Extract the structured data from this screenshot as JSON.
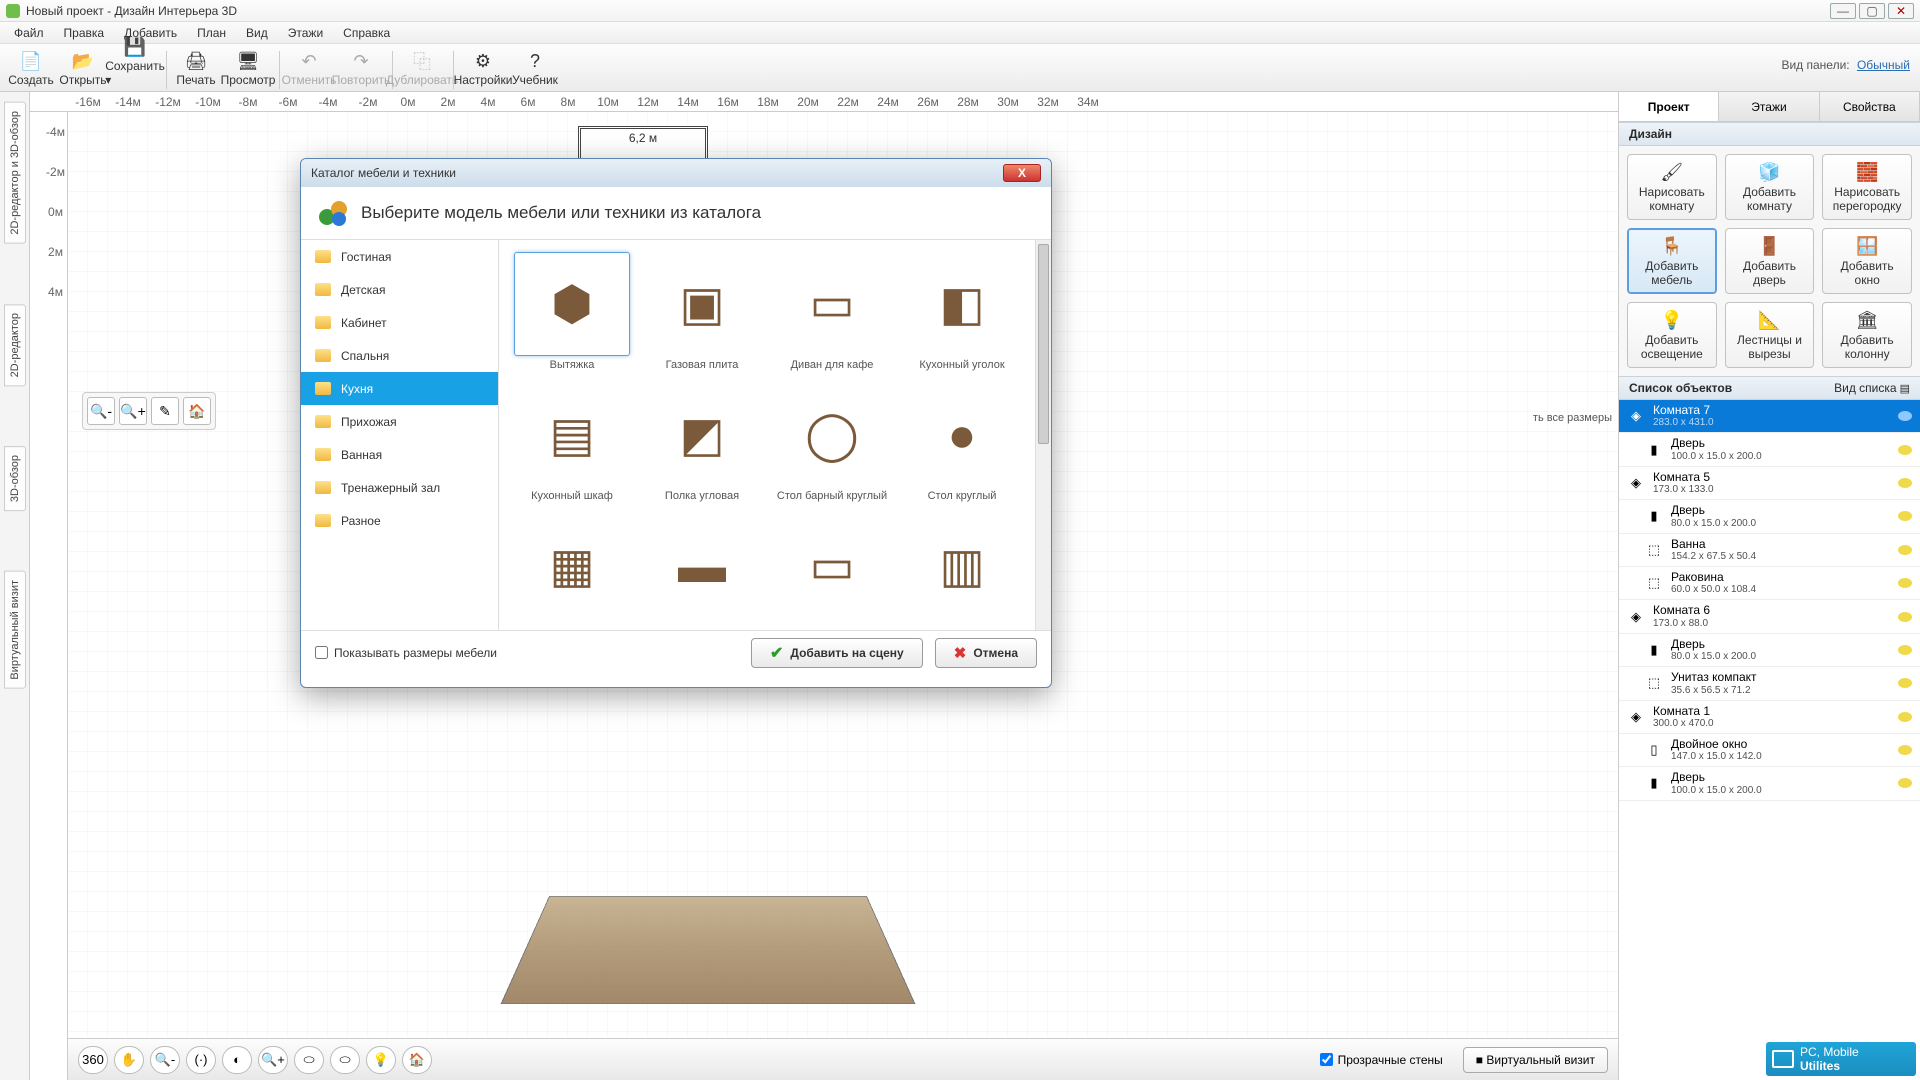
{
  "window": {
    "title": "Новый проект - Дизайн Интерьера 3D"
  },
  "menu": [
    "Файл",
    "Правка",
    "Добавить",
    "План",
    "Вид",
    "Этажи",
    "Справка"
  ],
  "toolbar": {
    "items": [
      {
        "label": "Создать",
        "icon": "📄"
      },
      {
        "label": "Открыть",
        "icon": "📂"
      },
      {
        "label": "Сохранить",
        "icon": "💾",
        "dropdown": true
      }
    ],
    "items2": [
      {
        "label": "Печать",
        "icon": "🖨"
      },
      {
        "label": "Просмотр",
        "icon": "🖥"
      }
    ],
    "items3": [
      {
        "label": "Отменить",
        "icon": "↶",
        "disabled": true
      },
      {
        "label": "Повторить",
        "icon": "↷",
        "disabled": true
      }
    ],
    "items4": [
      {
        "label": "Дублировать",
        "icon": "⿻",
        "disabled": true
      }
    ],
    "items5": [
      {
        "label": "Настройки",
        "icon": "⚙"
      },
      {
        "label": "Учебник",
        "icon": "?"
      }
    ],
    "panel_label": "Вид панели:",
    "panel_mode": "Обычный"
  },
  "left_tabs": [
    "2D-редактор и 3D-обзор",
    "2D-редактор",
    "3D-обзор",
    "Виртуальный визит"
  ],
  "ruler_h": [
    "-16м",
    "-14м",
    "-12м",
    "-10м",
    "-8м",
    "-6м",
    "-4м",
    "-2м",
    "0м",
    "2м",
    "4м",
    "6м",
    "8м",
    "10м",
    "12м",
    "14м",
    "16м",
    "18м",
    "20м",
    "22м",
    "24м",
    "26м",
    "28м",
    "30м",
    "32м",
    "34м"
  ],
  "ruler_v": [
    "-4м",
    "-2м",
    "0м",
    "2м",
    "4м"
  ],
  "room_label": "6,2 м",
  "palette": [
    "🔍-",
    "🔍+",
    "✎",
    "🏠"
  ],
  "bottom_tools": [
    "360",
    "✋",
    "🔍-",
    "(·)",
    "◐",
    "🔍+",
    "⬭",
    "⬭",
    "💡",
    "🏠"
  ],
  "bottom": {
    "checkbox": "Прозрачные стены",
    "virtual": "Виртуальный визит"
  },
  "dialog": {
    "title": "Каталог мебели и техники",
    "header": "Выберите модель мебели или техники из каталога",
    "categories": [
      "Гостиная",
      "Детская",
      "Кабинет",
      "Спальня",
      "Кухня",
      "Прихожая",
      "Ванная",
      "Тренажерный зал",
      "Разное"
    ],
    "selected_category": "Кухня",
    "items": [
      "Вытяжка",
      "Газовая плита",
      "Диван для кафе",
      "Кухонный уголок",
      "Кухонный шкаф",
      "Полка угловая",
      "Стол барный круглый",
      "Стол круглый",
      "",
      "",
      "",
      ""
    ],
    "selected_item": "Вытяжка",
    "show_sizes": "Показывать размеры мебели",
    "add": "Добавить на сцену",
    "cancel": "Отмена",
    "all_sizes_hint": "ть все размеры"
  },
  "sidebar": {
    "tabs": [
      "Проект",
      "Этажи",
      "Свойства"
    ],
    "design_header": "Дизайн",
    "design_buttons": [
      {
        "label": "Нарисовать\nкомнату",
        "icon": "🖌"
      },
      {
        "label": "Добавить\nкомнату",
        "icon": "🧊"
      },
      {
        "label": "Нарисовать\nперегородку",
        "icon": "🧱"
      },
      {
        "label": "Добавить\nмебель",
        "icon": "🪑",
        "active": true
      },
      {
        "label": "Добавить\nдверь",
        "icon": "🚪"
      },
      {
        "label": "Добавить\nокно",
        "icon": "🪟"
      },
      {
        "label": "Добавить\nосвещение",
        "icon": "💡"
      },
      {
        "label": "Лестницы и\nвырезы",
        "icon": "📐"
      },
      {
        "label": "Добавить\nколонну",
        "icon": "🏛"
      }
    ],
    "objects_header": "Список объектов",
    "list_view": "Вид списка",
    "objects": [
      {
        "name": "Комната 7",
        "dim": "283.0 x 431.0",
        "icon": "◈",
        "selected": true
      },
      {
        "name": "Дверь",
        "dim": "100.0 x 15.0 x 200.0",
        "icon": "▮",
        "indent": true
      },
      {
        "name": "Комната 5",
        "dim": "173.0 x 133.0",
        "icon": "◈"
      },
      {
        "name": "Дверь",
        "dim": "80.0 x 15.0 x 200.0",
        "icon": "▮",
        "indent": true
      },
      {
        "name": "Ванна",
        "dim": "154.2 x 67.5 x 50.4",
        "icon": "⬚",
        "indent": true
      },
      {
        "name": "Раковина",
        "dim": "60.0 x 50.0 x 108.4",
        "icon": "⬚",
        "indent": true
      },
      {
        "name": "Комната 6",
        "dim": "173.0 x 88.0",
        "icon": "◈"
      },
      {
        "name": "Дверь",
        "dim": "80.0 x 15.0 x 200.0",
        "icon": "▮",
        "indent": true
      },
      {
        "name": "Унитаз компакт",
        "dim": "35.6 x 56.5 x 71.2",
        "icon": "⬚",
        "indent": true
      },
      {
        "name": "Комната 1",
        "dim": "300.0 x 470.0",
        "icon": "◈"
      },
      {
        "name": "Двойное окно",
        "dim": "147.0 x 15.0 x 142.0",
        "icon": "▯",
        "indent": true
      },
      {
        "name": "Дверь",
        "dim": "100.0 x 15.0 x 200.0",
        "icon": "▮",
        "indent": true
      }
    ]
  },
  "badge": {
    "line1": "PC, Mobile",
    "line2": "Utilites"
  }
}
